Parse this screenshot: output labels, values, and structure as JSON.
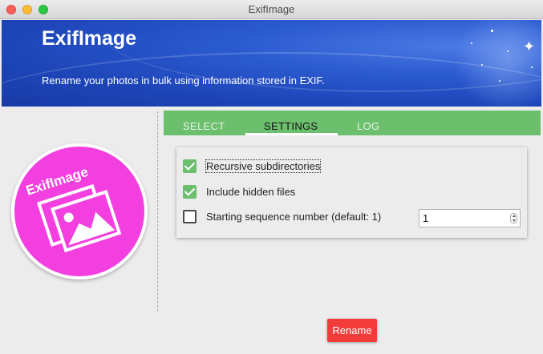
{
  "window": {
    "title": "ExifImage"
  },
  "header": {
    "app_name": "ExifImage",
    "tagline": "Rename your photos in bulk using information stored in EXIF."
  },
  "logo": {
    "text": "ExifImage"
  },
  "tabs": [
    {
      "label": "SELECT",
      "active": false
    },
    {
      "label": "SETTINGS",
      "active": true
    },
    {
      "label": "LOG",
      "active": false
    }
  ],
  "settings": {
    "recursive": {
      "label": "Recursive subdirectories",
      "checked": true
    },
    "hidden": {
      "label": "Include hidden files",
      "checked": true
    },
    "sequence": {
      "label": "Starting sequence number (default: 1)",
      "checked": false,
      "value": "1"
    }
  },
  "actions": {
    "rename_label": "Rename"
  },
  "colors": {
    "accent_green": "#6bbf6d",
    "rename_red": "#f23c3c",
    "logo_pink": "#f43fe0",
    "banner_blue": "#2b5ad0"
  }
}
